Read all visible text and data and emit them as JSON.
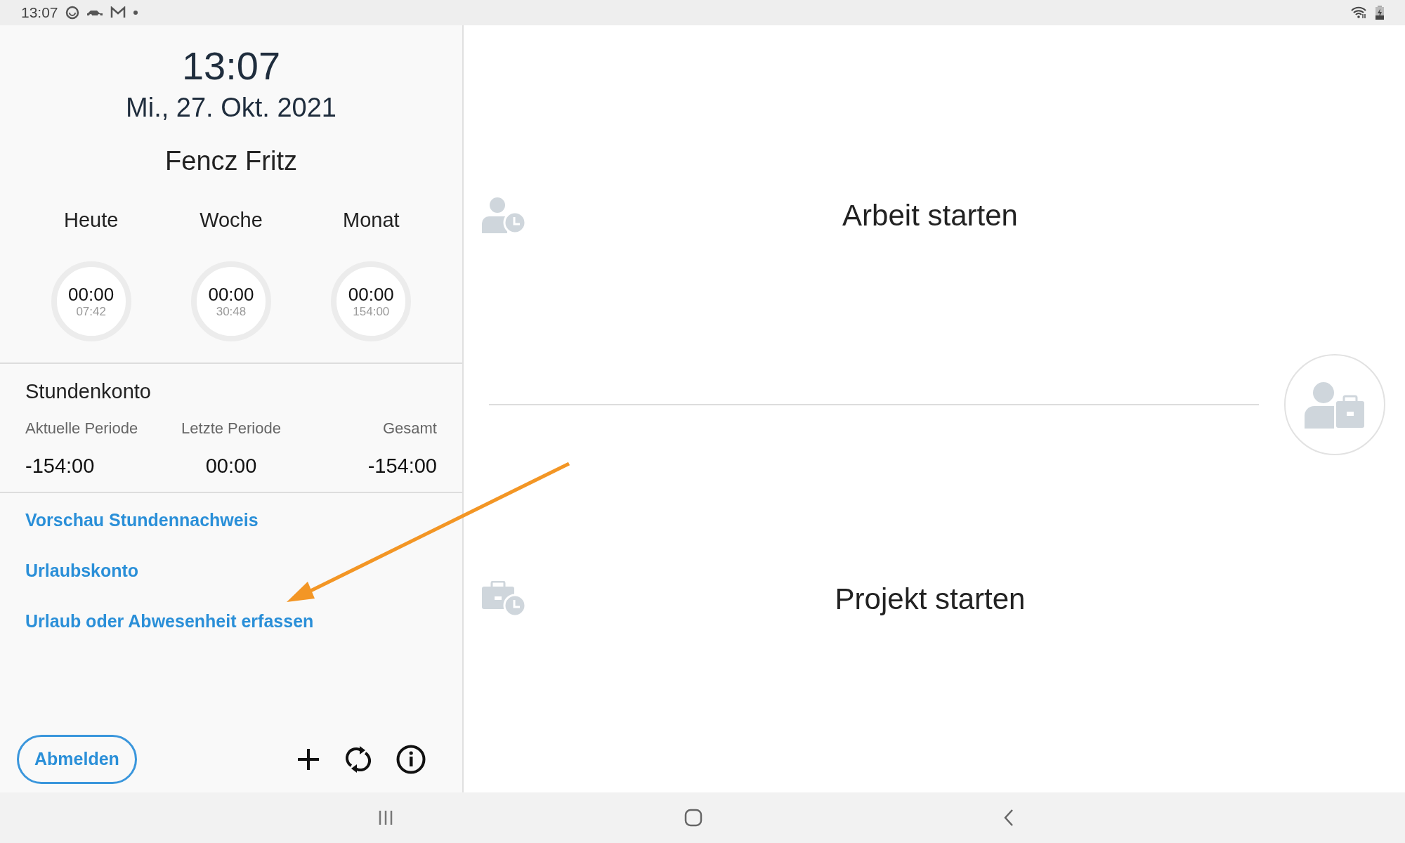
{
  "status_bar": {
    "time": "13:07"
  },
  "clock": {
    "time": "13:07",
    "date": "Mi., 27. Okt. 2021"
  },
  "user": {
    "name": "Fencz Fritz"
  },
  "counters": [
    {
      "label": "Heute",
      "value": "00:00",
      "target": "07:42",
      "level": 0
    },
    {
      "label": "Woche",
      "value": "00:00",
      "target": "30:48",
      "level": 0
    },
    {
      "label": "Monat",
      "value": "00:00",
      "target": "154:00",
      "level": 0
    }
  ],
  "hour_account": {
    "title": "Stundenkonto",
    "columns": [
      {
        "label": "Aktuelle Periode",
        "value": "-154:00"
      },
      {
        "label": "Letzte Periode",
        "value": "00:00"
      },
      {
        "label": "Gesamt",
        "value": "-154:00"
      }
    ]
  },
  "links": [
    "Vorschau Stundennachweis",
    "Urlaubskonto",
    "Urlaub oder Abwesenheit erfassen"
  ],
  "logout_button": "Abmelden",
  "actions": [
    {
      "kind": "work",
      "label": "Arbeit starten"
    },
    {
      "kind": "project",
      "label": "Projekt starten"
    }
  ]
}
